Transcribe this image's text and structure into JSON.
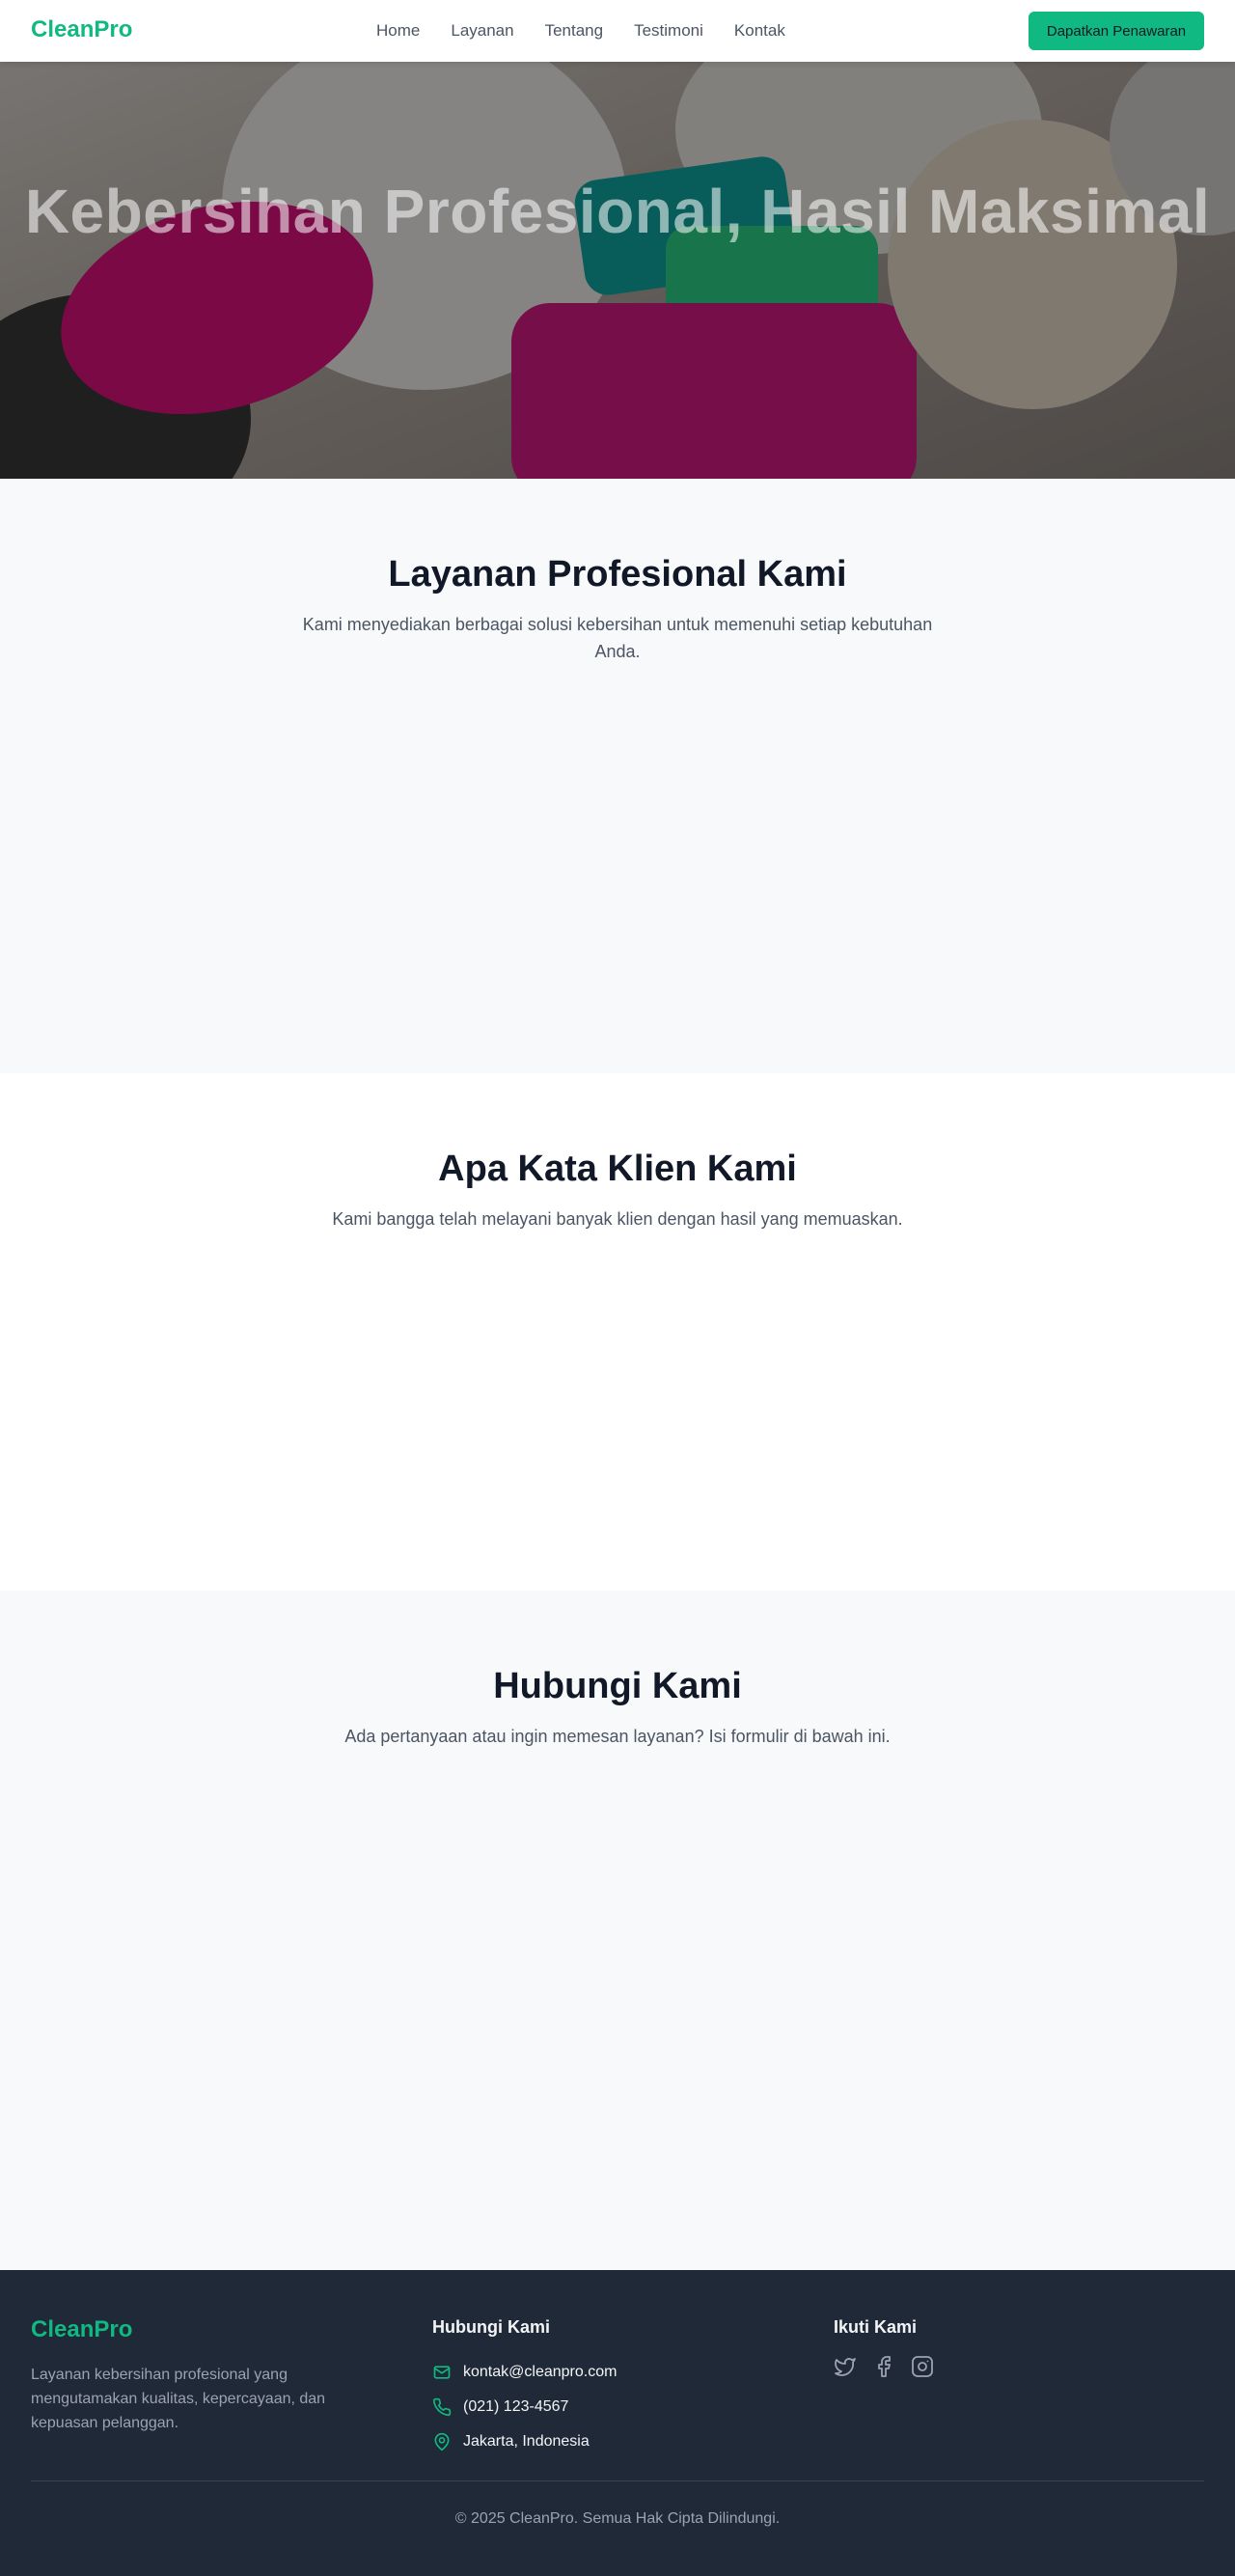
{
  "brand": {
    "name": "CleanPro",
    "accent": "#10b981"
  },
  "nav": {
    "items": [
      "Home",
      "Layanan",
      "Tentang",
      "Testimoni",
      "Kontak"
    ]
  },
  "header": {
    "cta_label": "Dapatkan Penawaran"
  },
  "hero": {
    "title": "Kebersihan Profesional, Hasil Maksimal"
  },
  "services": {
    "title": "Layanan Profesional Kami",
    "subtitle": "Kami menyediakan berbagai solusi kebersihan untuk memenuhi setiap kebutuhan Anda."
  },
  "testimonials": {
    "title": "Apa Kata Klien Kami",
    "subtitle": "Kami bangga telah melayani banyak klien dengan hasil yang memuaskan."
  },
  "contact": {
    "title": "Hubungi Kami",
    "subtitle": "Ada pertanyaan atau ingin memesan layanan? Isi formulir di bawah ini."
  },
  "footer": {
    "brand": "CleanPro",
    "description": "Layanan kebersihan profesional yang mengutamakan kualitas, kepercayaan, dan kepuasan pelanggan.",
    "contact_title": "Hubungi Kami",
    "email": "kontak@cleanpro.com",
    "phone": "(021) 123-4567",
    "location": "Jakarta, Indonesia",
    "social_title": "Ikuti Kami",
    "social_icons": [
      "twitter-icon",
      "facebook-icon",
      "instagram-icon"
    ],
    "copyright": "© 2025 CleanPro. Semua Hak Cipta Dilindungi."
  }
}
